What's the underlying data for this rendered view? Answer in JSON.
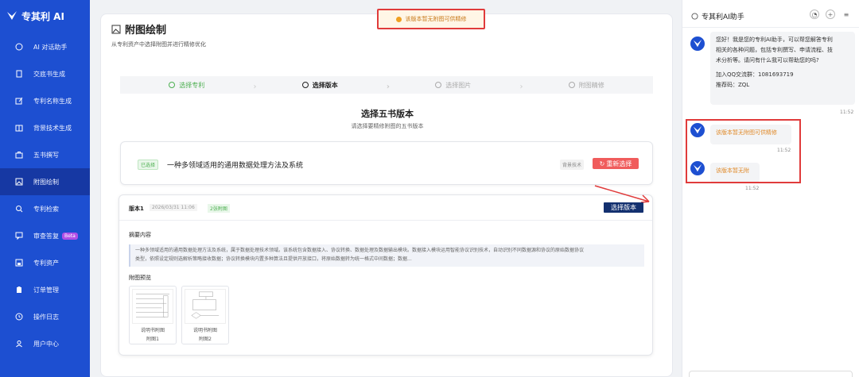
{
  "brand": {
    "name": "专其利 AI"
  },
  "sidebar": {
    "items": [
      {
        "label": "AI 对话助手",
        "icon": "chat-icon"
      },
      {
        "label": "交底书生成",
        "icon": "document-icon"
      },
      {
        "label": "专利名称生成",
        "icon": "edit-icon"
      },
      {
        "label": "背景技术生成",
        "icon": "book-icon"
      },
      {
        "label": "五书撰写",
        "icon": "briefcase-icon"
      },
      {
        "label": "附图绘制",
        "icon": "image-icon"
      },
      {
        "label": "专利检索",
        "icon": "search-icon"
      },
      {
        "label": "审查答复",
        "icon": "message-icon",
        "badge": "Beta"
      },
      {
        "label": "专利资产",
        "icon": "save-icon"
      },
      {
        "label": "订单管理",
        "icon": "clipboard-icon"
      },
      {
        "label": "操作日志",
        "icon": "clock-icon"
      },
      {
        "label": "用户中心",
        "icon": "user-icon"
      }
    ],
    "active_index": 5
  },
  "main": {
    "title": "附图绘制",
    "subtitle": "从专利资产中选择附图并进行精修优化",
    "toast": "该版本暂无附图可供精修",
    "steps": [
      {
        "label": "选择专利",
        "state": "done"
      },
      {
        "label": "选择版本",
        "state": "current"
      },
      {
        "label": "选择图片",
        "state": "pending"
      },
      {
        "label": "附图精修",
        "state": "pending"
      }
    ],
    "section_title": "选择五书版本",
    "section_subtitle": "请选择要精修附图的五书版本",
    "selected": {
      "tag": "已选择",
      "name": "一种多领域适用的通用数据处理方法及系统",
      "kind": "背景技术",
      "reselect_label": "重新选择"
    },
    "version": {
      "name": "版本1",
      "date": "2026/03/31 11:06",
      "count": "2张附图",
      "choose_label": "选择版本",
      "abstract_label": "摘要内容",
      "abstract_line1": "一种多领域适用的通用数据处理方法及系统，属于数据处理技术领域。该系统包含数据接入、协议转换、数据处理及数据输出模块。数据接入模块运用智能协议识别技术，自动识别不同数据源和协议的原始数据协议",
      "abstract_line2": "类型，依照设定规则选解析策略接收数据；协议转换模块内置多种算法且提供开放接口，将原始数据转为统一格式中间数据；数据...",
      "preview_label": "附图预览",
      "thumbs": [
        {
          "cap1": "说明书附图",
          "cap2": "附图1"
        },
        {
          "cap1": "说明书附图",
          "cap2": "附图2"
        }
      ]
    }
  },
  "assistant": {
    "title": "专其利AI助手",
    "greeting_l1": "您好！我是您的专利AI助手，可以帮您解答专利",
    "greeting_l2": "相关的各种问题，包括专利撰写、申请流程、技",
    "greeting_l3": "术分析等。请问有什么我可以帮助您的吗?",
    "greeting_l4": "加入QQ交流群：1081693719",
    "greeting_l5": "推荐码：ZQL",
    "time1": "11:52",
    "msg2": "该版本暂无附图可供精修",
    "time2": "11:52",
    "msg3": "该版本暂无附",
    "time3": "11:52"
  },
  "colors": {
    "sidebar": "#1d4fd1",
    "accent_dark": "#13306f",
    "danger": "#f05c5c",
    "success": "#4caf50",
    "warning": "#e08a2a"
  }
}
